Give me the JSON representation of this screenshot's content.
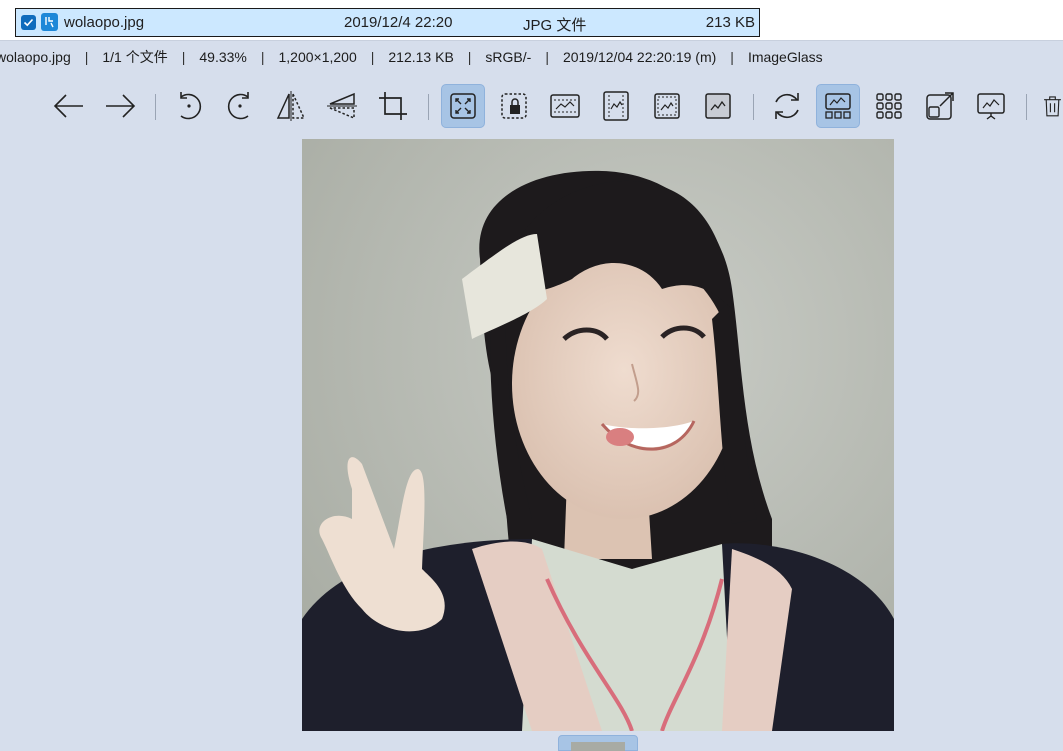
{
  "explorer_row": {
    "filename": "wolaopo.jpg",
    "date": "2019/12/4 22:20",
    "type": "JPG 文件",
    "size": "213 KB"
  },
  "infobar": {
    "filename": "wolaopo.jpg",
    "file_index": "1/1 个文件",
    "zoom": "49.33%",
    "dimensions": "1,200×1,200",
    "filesize": "212.13 KB",
    "color_profile": "sRGB/-",
    "modified": "2019/12/04 22:20:19 (m)",
    "app_name": "ImageGlass"
  },
  "toolbar": {
    "buttons": [
      {
        "icon": "arrow-left-icon",
        "active": false
      },
      {
        "icon": "arrow-right-icon",
        "active": false
      },
      {
        "icon": "rotate-left-icon",
        "active": false
      },
      {
        "icon": "rotate-right-icon",
        "active": false
      },
      {
        "icon": "flip-horizontal-icon",
        "active": false
      },
      {
        "icon": "flip-vertical-icon",
        "active": false
      },
      {
        "icon": "crop-icon",
        "active": false
      },
      {
        "icon": "auto-zoom-icon",
        "active": true
      },
      {
        "icon": "lock-zoom-icon",
        "active": false
      },
      {
        "icon": "scale-to-width-icon",
        "active": false
      },
      {
        "icon": "scale-to-height-icon",
        "active": false
      },
      {
        "icon": "scale-to-fit-icon",
        "active": false
      },
      {
        "icon": "scale-to-fill-icon",
        "active": false
      },
      {
        "icon": "refresh-icon",
        "active": false
      },
      {
        "icon": "thumbnail-bar-icon",
        "active": true
      },
      {
        "icon": "gallery-grid-icon",
        "active": false
      },
      {
        "icon": "fullscreen-icon",
        "active": false
      },
      {
        "icon": "slideshow-icon",
        "active": false
      },
      {
        "icon": "trash-icon",
        "active": false
      }
    ]
  },
  "colors": {
    "background": "#d6deec",
    "active_button": "#a7c4e5",
    "selection_row": "#cce8ff",
    "checkbox": "#0f6cbd"
  }
}
